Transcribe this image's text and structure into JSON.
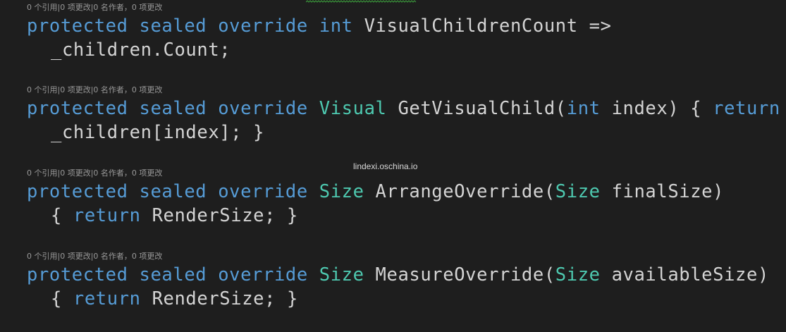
{
  "codelens": "0 个引用|0 项更改|0 名作者，0 项更改",
  "watermark": "lindexi.oschina.io",
  "colors": {
    "background": "#1e1e1e",
    "keyword": "#569cd6",
    "type": "#4ec9b0",
    "text": "#d4d4d4",
    "lens": "#999999",
    "squiggle": "#3c9e3c"
  },
  "blocks": [
    {
      "lens": "0 个引用|0 项更改|0 名作者，0 项更改",
      "line1": {
        "kw1": "protected",
        "kw2": "sealed",
        "kw3": "override",
        "type": "int",
        "rest": "VisualChildrenCount =>"
      },
      "line2": "_children.Count;"
    },
    {
      "lens": "0 个引用|0 项更改|0 名作者，0 项更改",
      "line1": {
        "kw1": "protected",
        "kw2": "sealed",
        "kw3": "override",
        "type": "Visual",
        "name": "GetVisualChild(",
        "param_type": "int",
        "rest": "index) {",
        "kw_return": "return"
      },
      "line2": "_children[index]; }"
    },
    {
      "lens": "0 个引用|0 项更改|0 名作者，0 项更改",
      "line1": {
        "kw1": "protected",
        "kw2": "sealed",
        "kw3": "override",
        "type": "Size",
        "name": "ArrangeOverride(",
        "param_type": "Size",
        "rest": "finalSize)"
      },
      "line2": {
        "open": "{",
        "kw_return": "return",
        "rest": "RenderSize; }"
      }
    },
    {
      "lens": "0 个引用|0 项更改|0 名作者，0 项更改",
      "line1": {
        "kw1": "protected",
        "kw2": "sealed",
        "kw3": "override",
        "type": "Size",
        "name": "MeasureOverride(",
        "param_type": "Size",
        "rest": "availableSize)"
      },
      "line2": {
        "open": "{",
        "kw_return": "return",
        "rest": "RenderSize; }"
      }
    }
  ]
}
